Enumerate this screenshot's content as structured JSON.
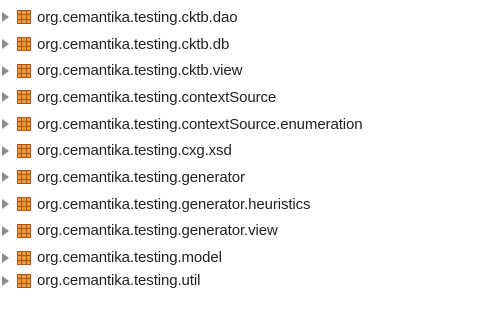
{
  "package_tree": {
    "items": [
      {
        "label": "org.cemantika.testing.cktb.dao",
        "icon": "package-icon"
      },
      {
        "label": "org.cemantika.testing.cktb.db",
        "icon": "package-icon"
      },
      {
        "label": "org.cemantika.testing.cktb.view",
        "icon": "package-icon"
      },
      {
        "label": "org.cemantika.testing.contextSource",
        "icon": "package-icon"
      },
      {
        "label": "org.cemantika.testing.contextSource.enumeration",
        "icon": "package-icon"
      },
      {
        "label": "org.cemantika.testing.cxg.xsd",
        "icon": "package-icon"
      },
      {
        "label": "org.cemantika.testing.generator",
        "icon": "package-icon"
      },
      {
        "label": "org.cemantika.testing.generator.heuristics",
        "icon": "package-icon"
      },
      {
        "label": "org.cemantika.testing.generator.view",
        "icon": "package-icon"
      },
      {
        "label": "org.cemantika.testing.model",
        "icon": "package-icon"
      },
      {
        "label": "org.cemantika.testing.util",
        "icon": "package-icon"
      }
    ]
  },
  "colors": {
    "package_icon_fill": "#e9a23b",
    "package_icon_stroke": "#b4541a",
    "disclosure_triangle": "#8c8c8c",
    "text": "#1f1f1f"
  }
}
